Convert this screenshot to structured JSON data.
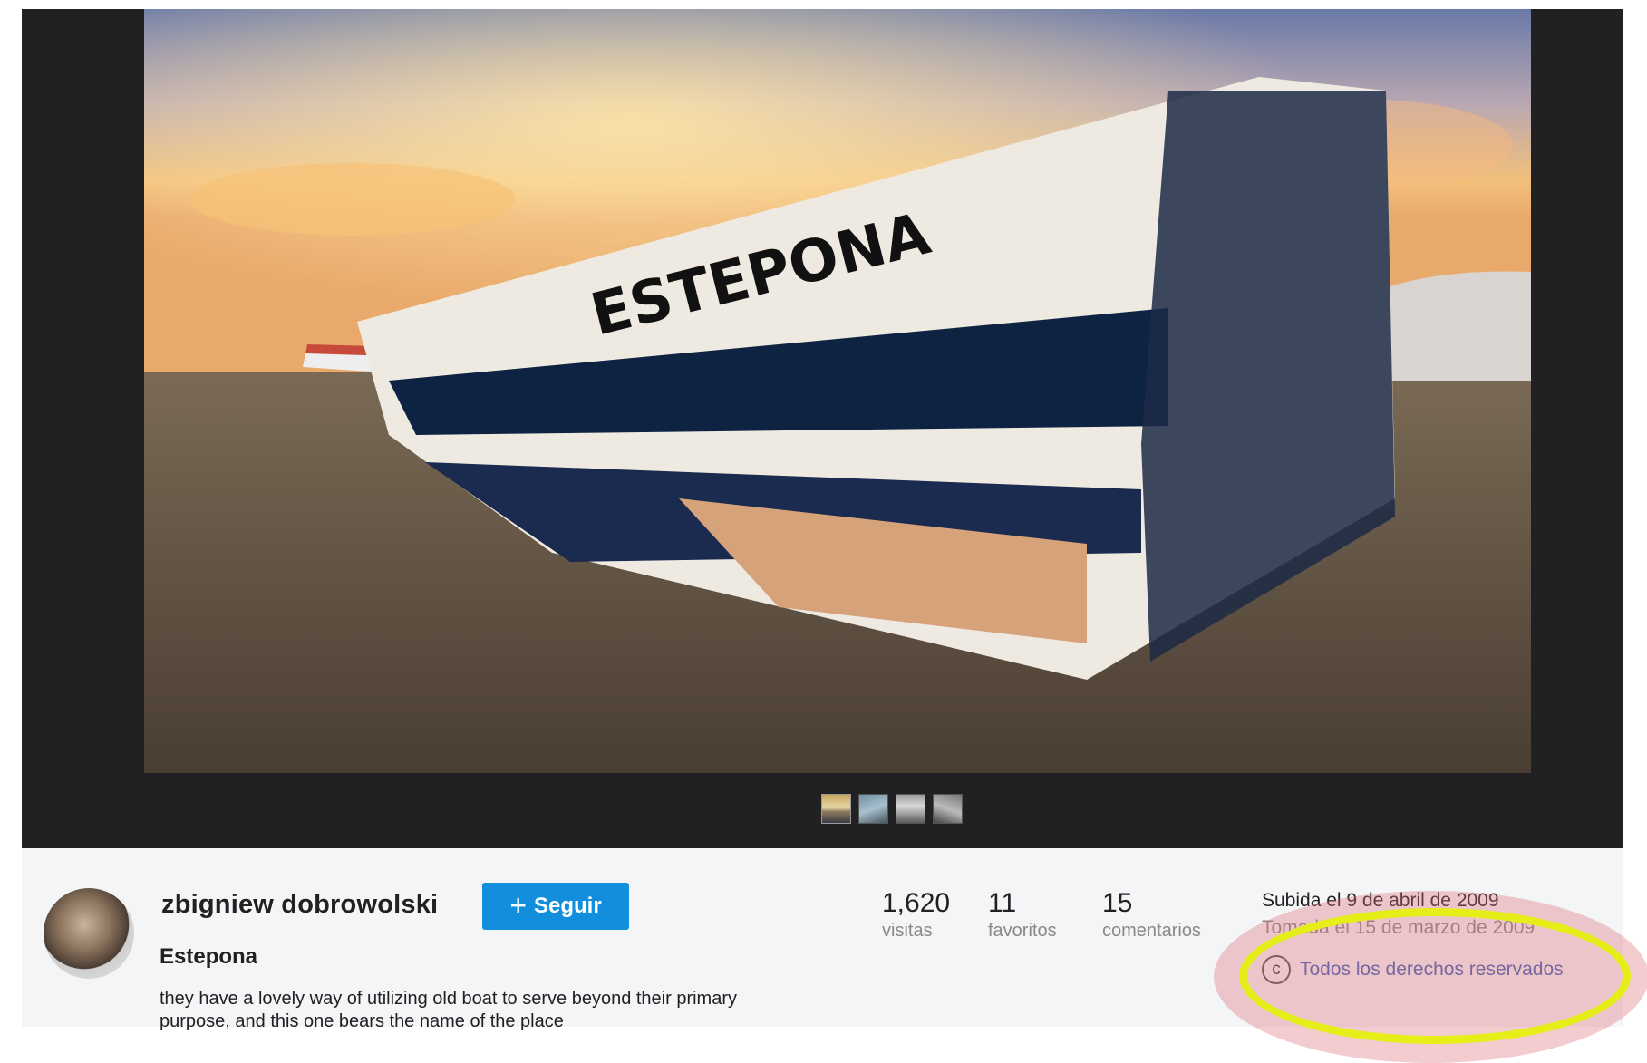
{
  "photo": {
    "boat_name": "ESTEPONA"
  },
  "thumbnails": [
    "thumbnail-1",
    "thumbnail-2",
    "thumbnail-3",
    "thumbnail-4"
  ],
  "owner": {
    "name": "zbigniew dobrowolski",
    "follow_label": "Seguir",
    "follow_icon": "plus-icon"
  },
  "title": "Estepona",
  "description": "they have a lovely way of utilizing old boat to serve beyond their primary purpose, and this one bears the name of the place",
  "stats": {
    "views": {
      "value": "1,620",
      "label": "visitas"
    },
    "faves": {
      "value": "11",
      "label": "favoritos"
    },
    "comments": {
      "value": "15",
      "label": "comentarios"
    }
  },
  "meta": {
    "uploaded": "Subida el 9 de abril de 2009",
    "taken": "Tomada el 15 de marzo de 2009",
    "license": "Todos los derechos reservados",
    "license_icon": "copyright-icon"
  },
  "colors": {
    "follow_button": "#128fdc",
    "viewer_bg": "#212124",
    "info_bg": "#f3f5f6",
    "license_link": "#3e66b7",
    "annotation_ring": "#e6ee1a"
  }
}
